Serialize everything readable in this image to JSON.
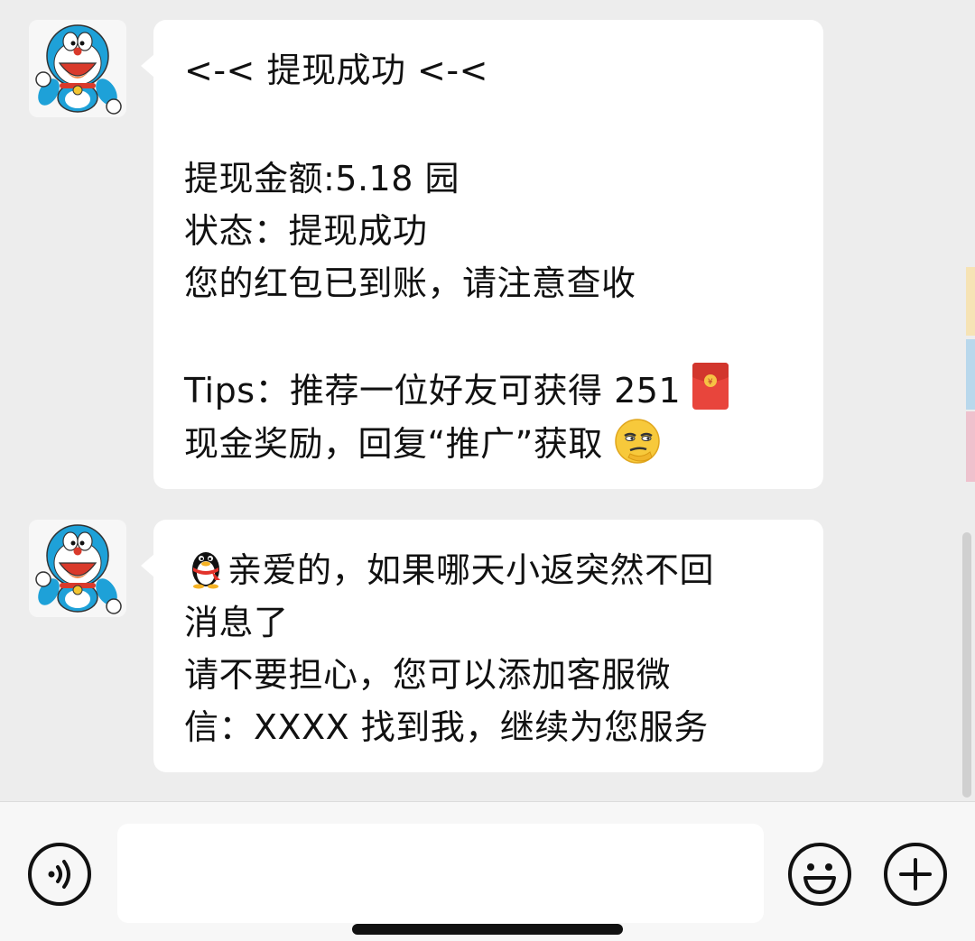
{
  "messages": [
    {
      "avatar_icon": "doraemon-avatar",
      "lines": [
        "<-< 提现成功 <-<",
        "",
        "提现金额:5.18 园",
        "状态：提现成功",
        "您的红包已到账，请注意查收",
        "",
        "Tips：推荐一位好友可获得 251",
        "现金奖励，回复“推广”获取"
      ],
      "inline_icons": [
        "red-envelope-icon",
        "smirk-face-emoji-icon"
      ]
    },
    {
      "avatar_icon": "doraemon-avatar",
      "lines": [
        "亲爱的，如果哪天小返突然不回",
        "消息了",
        "请不要担心，您可以添加客服微",
        "信：XXXX 找到我，继续为您服务"
      ],
      "inline_icons": [
        "qq-penguin-icon"
      ]
    }
  ],
  "toolbar": {
    "voice_icon": "voice-input-icon",
    "emoji_icon": "emoji-icon",
    "more_icon": "plus-icon",
    "input_value": ""
  },
  "colors": {
    "background": "#ededed",
    "bubble": "#ffffff",
    "red_envelope": "#e8453c",
    "side_tabs": [
      "#f6e3b5",
      "#b9d8ec",
      "#efc1cd"
    ]
  }
}
